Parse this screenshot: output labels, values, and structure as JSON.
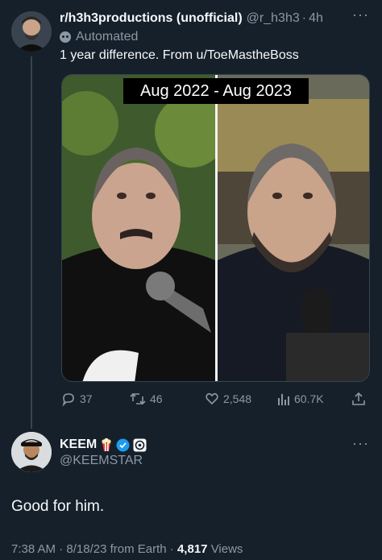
{
  "tweet1": {
    "display_name": "r/h3h3productions (unofficial)",
    "handle": "@r_h3h3",
    "separator": "·",
    "time": "4h",
    "more": "···",
    "automated_label": "Automated",
    "text": "1 year difference. From u/ToeMastheBoss",
    "media": {
      "caption": "Aug 2022 - Aug 2023",
      "alt_icon": "photo-comparison"
    },
    "actions": {
      "replies": "37",
      "reposts": "46",
      "likes": "2,548",
      "views": "60.7K"
    }
  },
  "tweet2": {
    "display_name": "KEEM",
    "handle": "@KEEMSTAR",
    "more": "···",
    "text": "Good for him.",
    "footer": {
      "time": "7:38 AM",
      "dot": "·",
      "date": "8/18/23 from Earth",
      "dot2": "·",
      "views_count": "4,817",
      "views_label": "Views"
    }
  },
  "colors": {
    "background": "#15202b",
    "text_primary": "#f7f9f9",
    "text_secondary": "#8b98a5",
    "verified": "#1d9bf0"
  }
}
